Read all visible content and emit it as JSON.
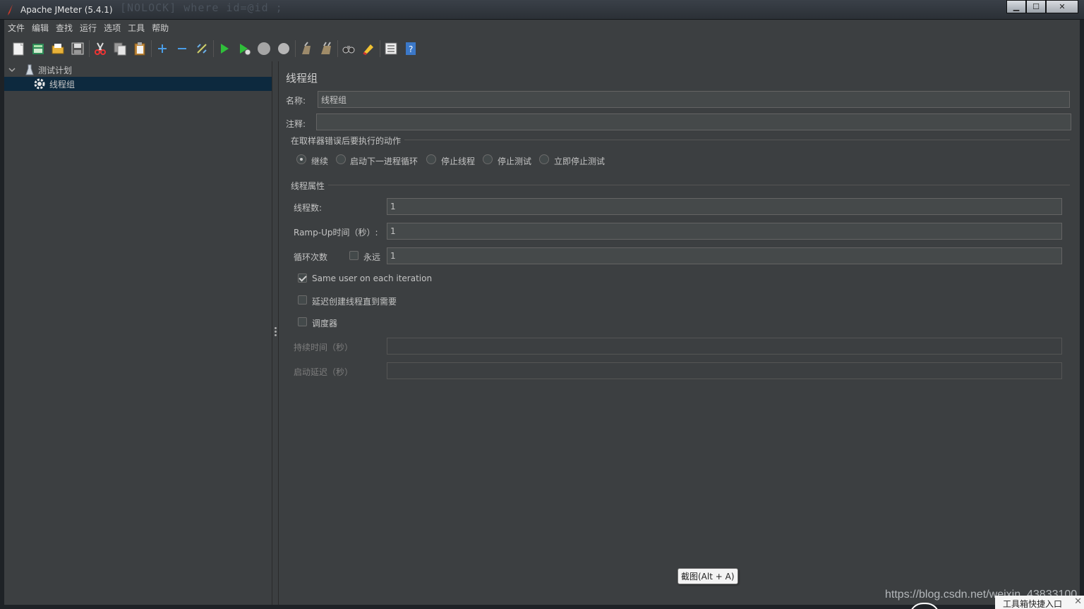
{
  "window": {
    "title": "Apache JMeter (5.4.1)",
    "background_ghost": "[NOLOCK] where id=@id ;"
  },
  "controls": {
    "minimize": "▁",
    "maximize": "☐",
    "close": "✕"
  },
  "menu": [
    "文件",
    "编辑",
    "查找",
    "运行",
    "选项",
    "工具",
    "帮助"
  ],
  "toolbar_icons": [
    "new-icon",
    "templates-icon",
    "open-icon",
    "save-icon",
    "cut-icon",
    "copy-icon",
    "paste-icon",
    "expand-icon",
    "collapse-icon",
    "toggle-icon",
    "start-icon",
    "start-no-pause-icon",
    "stop-icon",
    "shutdown-icon",
    "clear-icon",
    "clear-all-icon",
    "search-icon",
    "reset-search-icon",
    "function-helper-icon",
    "help-icon"
  ],
  "tree": {
    "root": {
      "label": "测试计划"
    },
    "child": {
      "label": "线程组"
    }
  },
  "panel": {
    "title": "线程组",
    "name_label": "名称:",
    "name_value": "线程组",
    "comment_label": "注释:",
    "comment_value": "",
    "error_section": "在取样器错误后要执行的动作",
    "error_options": [
      "继续",
      "启动下一进程循环",
      "停止线程",
      "停止测试",
      "立即停止测试"
    ],
    "error_selected": 0,
    "thread_section": "线程属性",
    "threads_label": "线程数:",
    "threads_value": "1",
    "rampup_label": "Ramp-Up时间（秒）:",
    "rampup_value": "1",
    "loop_label": "循环次数",
    "forever_label": "永远",
    "forever_checked": false,
    "loop_value": "1",
    "same_user_label": "Same user on each iteration",
    "same_user_checked": true,
    "delay_create_label": "延迟创建线程直到需要",
    "delay_create_checked": false,
    "scheduler_label": "调度器",
    "scheduler_checked": false,
    "duration_label": "持续时间（秒）",
    "duration_value": "",
    "startup_delay_label": "启动延迟（秒）",
    "startup_delay_value": ""
  },
  "overlay": {
    "tooltip": "截图(Alt + A)",
    "watermark": "https://blog.csdn.net/weixin_43833100",
    "quick_entry": "工具箱快捷入口",
    "quick_entry_close": "✕"
  }
}
